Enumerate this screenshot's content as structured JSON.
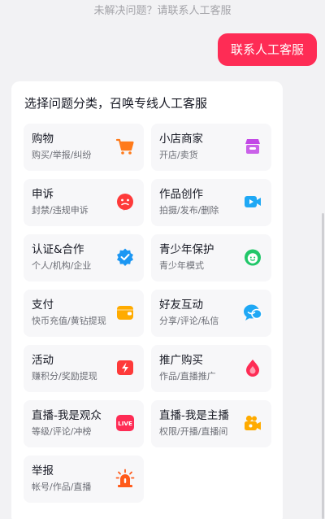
{
  "chat": {
    "system_hint": "未解决问题？请联系人工客服",
    "user_message": "联系人工客服"
  },
  "card": {
    "title": "选择问题分类，召唤专线人工客服",
    "categories": [
      {
        "title": "购物",
        "subtitle": "购买/举报/纠纷",
        "icon": "shopping-cart-icon",
        "color": "#ff7a1a"
      },
      {
        "title": "小店商家",
        "subtitle": "开店/卖货",
        "icon": "shop-icon",
        "color": "#c247e6"
      },
      {
        "title": "申诉",
        "subtitle": "封禁/违规申诉",
        "icon": "appeal-icon",
        "color": "#fe3a3a"
      },
      {
        "title": "作品创作",
        "subtitle": "拍摄/发布/删除",
        "icon": "video-camera-icon",
        "color": "#1fa8f5"
      },
      {
        "title": "认证&合作",
        "subtitle": "个人/机构/企业",
        "icon": "verified-badge-icon",
        "color": "#1c97f3"
      },
      {
        "title": "青少年保护",
        "subtitle": "青少年模式",
        "icon": "smile-face-icon",
        "color": "#22c76a"
      },
      {
        "title": "支付",
        "subtitle": "快币充值/黄钻提现",
        "icon": "wallet-icon",
        "color": "#ffab00"
      },
      {
        "title": "好友互动",
        "subtitle": "分享/评论/私信",
        "icon": "chat-bubbles-icon",
        "color": "#1fa8f5"
      },
      {
        "title": "活动",
        "subtitle": "赚积分/奖励提现",
        "icon": "lightning-icon",
        "color": "#fe3a3a"
      },
      {
        "title": "推广购买",
        "subtitle": "作品/直播推广",
        "icon": "flame-drop-icon",
        "color": "#fe2c55"
      },
      {
        "title": "直播-我是观众",
        "subtitle": "等级/评论/冲榜",
        "icon": "live-badge-icon",
        "color": "#fe2c55",
        "badge_text": "LIVE"
      },
      {
        "title": "直播-我是主播",
        "subtitle": "权限/开播/直播间",
        "icon": "camera-icon",
        "color": "#ffab00"
      },
      {
        "title": "举报",
        "subtitle": "帐号/作品/直播",
        "icon": "alarm-siren-icon",
        "color": "#ff5a1a"
      }
    ]
  }
}
